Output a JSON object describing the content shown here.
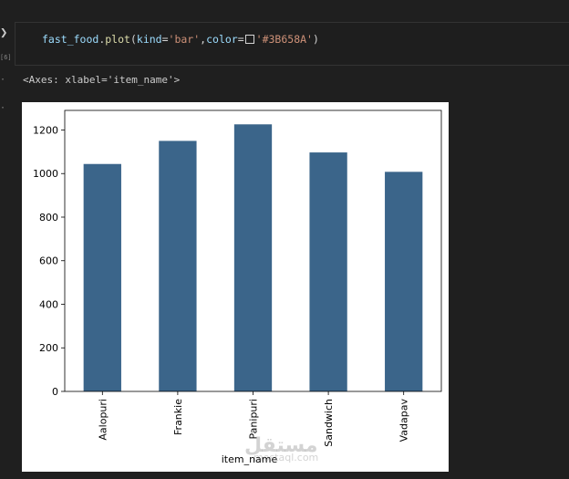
{
  "cell": {
    "code_name": "fast_food",
    "code_method": "plot",
    "code_kwarg_kind": "kind",
    "code_kind_value": "'bar'",
    "code_kwarg_color": "color",
    "code_color_value": "'#3B658A'"
  },
  "output": {
    "repr_text": "<Axes: xlabel='item_name'>"
  },
  "gutter": {
    "run_icon": "run-icon",
    "exec_count": "[6]"
  },
  "watermark": {
    "main": "مستقل",
    "sub": "mostaql.com"
  },
  "chart_data": {
    "type": "bar",
    "categories": [
      "Aalopuri",
      "Frankie",
      "Panipuri",
      "Sandwich",
      "Vadapav"
    ],
    "values": [
      1044,
      1150,
      1226,
      1097,
      1008
    ],
    "bar_color": "#3B658A",
    "xlabel": "item_name",
    "ylabel": "",
    "ylim": [
      0,
      1290
    ],
    "yticks": [
      0,
      200,
      400,
      600,
      800,
      1000,
      1200
    ],
    "grid": false,
    "legend": "none"
  }
}
